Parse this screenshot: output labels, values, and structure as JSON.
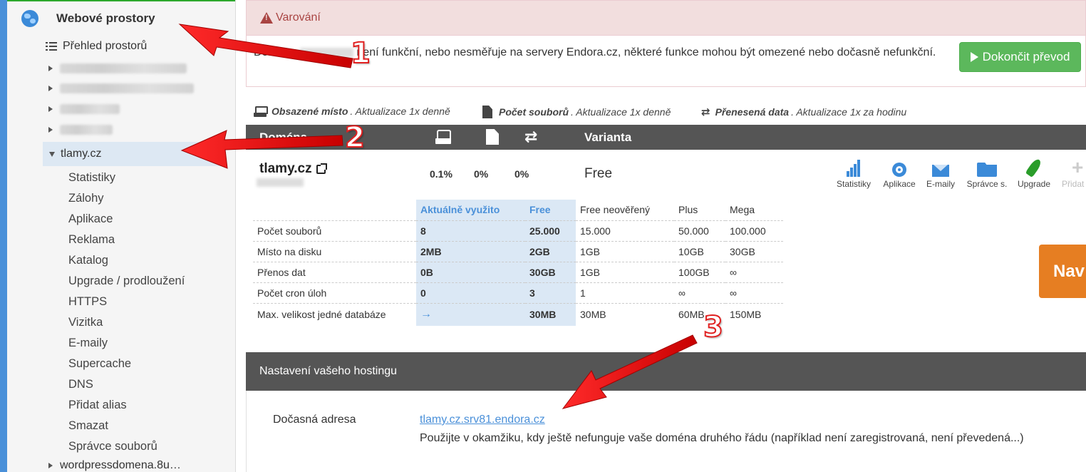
{
  "sidebar": {
    "title": "Webové prostory",
    "overview": "Přehled prostorů",
    "active_domain": "tlamy.cz",
    "sub_items": [
      "Statistiky",
      "Zálohy",
      "Aplikace",
      "Reklama",
      "Katalog",
      "Upgrade / prodloužení",
      "HTTPS",
      "Vizitka",
      "E-maily",
      "Supercache",
      "DNS",
      "Přidat alias",
      "Smazat",
      "Správce souborů"
    ],
    "last_domain": "wordpressdomena.8u…"
  },
  "warning": {
    "title": "Varování",
    "text_start": "Doména",
    "text_end": "není funkční, nebo nesměřuje na servery Endora.cz, některé funkce mohou být omezené nebo dočasně nefunkční.",
    "button": "Dokončit převod"
  },
  "legend": {
    "disk_label": "Obsazené místo",
    "disk_note": ". Aktualizace 1x denně",
    "files_label": "Počet souborů",
    "files_note": ". Aktualizace 1x denně",
    "transfer_label": "Přenesená data",
    "transfer_note": ". Aktualizace 1x za hodinu"
  },
  "table_head": {
    "domain": "Doména",
    "variant": "Varianta"
  },
  "domain_row": {
    "name": "tlamy.cz",
    "disk": "0.1%",
    "files": "0%",
    "transfer": "0%",
    "variant": "Free"
  },
  "tools": [
    "Statistiky",
    "Aplikace",
    "E-maily",
    "Správce s.",
    "Upgrade",
    "Přidat"
  ],
  "comparison": {
    "headers": [
      "",
      "Aktuálně využito",
      "Free",
      "Free neověřený",
      "Plus",
      "Mega"
    ],
    "rows": [
      [
        "Počet souborů",
        "8",
        "25.000",
        "15.000",
        "50.000",
        "100.000"
      ],
      [
        "Místo na disku",
        "2MB",
        "2GB",
        "1GB",
        "10GB",
        "30GB"
      ],
      [
        "Přenos dat",
        "0B",
        "30GB",
        "1GB",
        "100GB",
        "∞"
      ],
      [
        "Počet cron úloh",
        "0",
        "3",
        "1",
        "∞",
        "∞"
      ],
      [
        "Max. velikost jedné databáze",
        "→",
        "30MB",
        "30MB",
        "60MB",
        "150MB"
      ]
    ]
  },
  "nav_button": "Nav",
  "settings": {
    "title": "Nastavení vašeho hostingu",
    "temp_label": "Dočasná adresa",
    "temp_link": "tlamy.cz.srv81.endora.cz",
    "temp_note": "Použijte v okamžiku, kdy ještě nefunguje vaše doména druhého řádu (například není zaregistrovaná, není převedená...)"
  },
  "annotations": [
    "1",
    "2",
    "3"
  ],
  "colors": {
    "accent": "#4a90d9",
    "green": "#5cb85c",
    "orange": "#e67e22",
    "warning_bg": "#f2dede",
    "arrow": "#e02020"
  }
}
